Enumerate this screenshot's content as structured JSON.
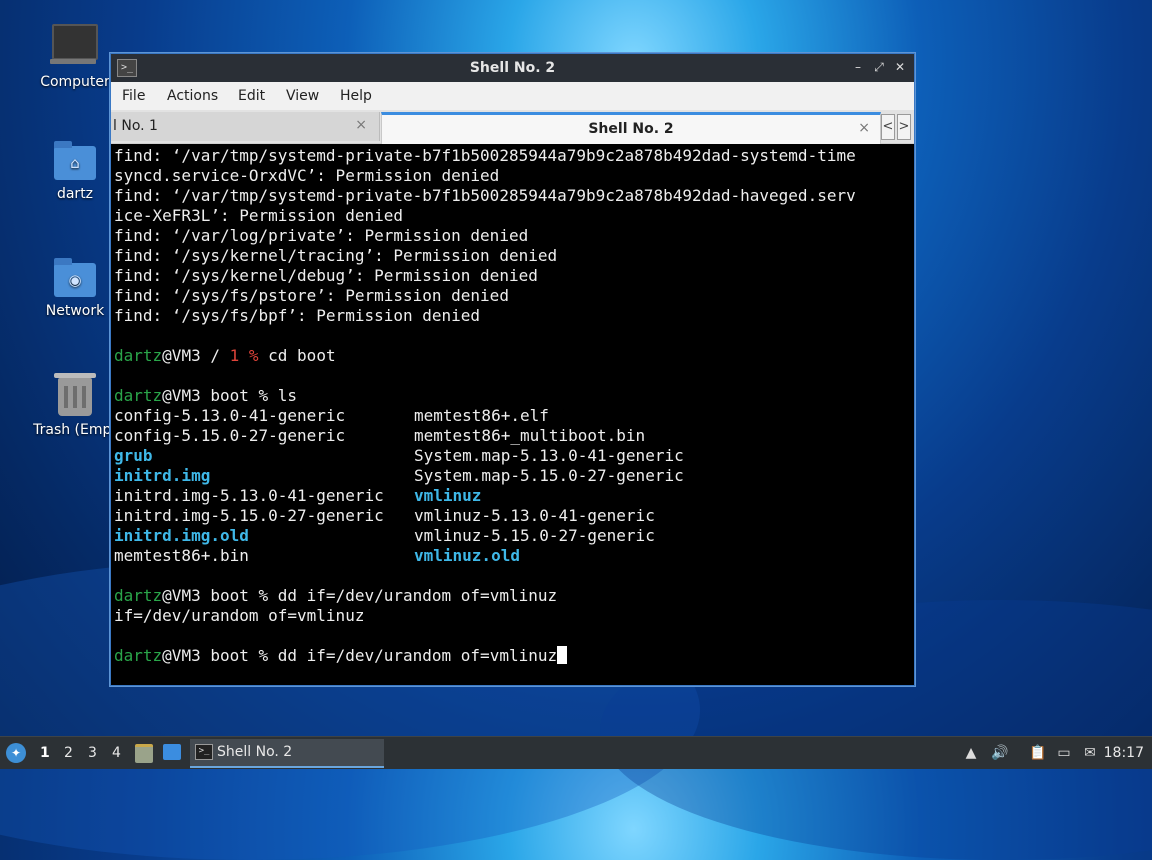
{
  "desktop": {
    "icons": [
      {
        "label": "Computer"
      },
      {
        "label": "dartz"
      },
      {
        "label": "Network"
      },
      {
        "label": "Trash (Empt"
      }
    ]
  },
  "window": {
    "title": "Shell No. 2",
    "menu": [
      "File",
      "Actions",
      "Edit",
      "View",
      "Help"
    ],
    "tabs": [
      {
        "label": "l No. 1",
        "close": "×"
      },
      {
        "label": "Shell No. 2",
        "close": "×"
      }
    ],
    "controls": {
      "minimize": "–",
      "maximize": "⤢",
      "close": "✕"
    },
    "scroll_left": "<",
    "scroll_right": ">"
  },
  "terminal": {
    "lines": [
      "find: ‘/var/tmp/systemd-private-b7f1b500285944a79b9c2a878b492dad-systemd-time",
      "syncd.service-OrxdVC’: Permission denied",
      "find: ‘/var/tmp/systemd-private-b7f1b500285944a79b9c2a878b492dad-haveged.serv",
      "ice-XeFR3L’: Permission denied",
      "find: ‘/var/log/private’: Permission denied",
      "find: ‘/sys/kernel/tracing’: Permission denied",
      "find: ‘/sys/kernel/debug’: Permission denied",
      "find: ‘/sys/fs/pstore’: Permission denied",
      "find: ‘/sys/fs/bpf’: Permission denied"
    ],
    "prompt1": {
      "user": "dartz",
      "host_path": "@VM3 / ",
      "exit": "1 %",
      "cmd": " cd boot"
    },
    "prompt2": {
      "user": "dartz",
      "rest": "@VM3 boot % ls"
    },
    "ls": [
      {
        "left": "config-5.13.0-41-generic",
        "left_dir": false,
        "right": "memtest86+.elf",
        "right_dir": false
      },
      {
        "left": "config-5.15.0-27-generic",
        "left_dir": false,
        "right": "memtest86+_multiboot.bin",
        "right_dir": false
      },
      {
        "left": "grub",
        "left_dir": true,
        "right": "System.map-5.13.0-41-generic",
        "right_dir": false
      },
      {
        "left": "initrd.img",
        "left_dir": true,
        "right": "System.map-5.15.0-27-generic",
        "right_dir": false
      },
      {
        "left": "initrd.img-5.13.0-41-generic",
        "left_dir": false,
        "right": "vmlinuz",
        "right_dir": true
      },
      {
        "left": "initrd.img-5.15.0-27-generic",
        "left_dir": false,
        "right": "vmlinuz-5.13.0-41-generic",
        "right_dir": false
      },
      {
        "left": "initrd.img.old",
        "left_dir": true,
        "right": "vmlinuz-5.15.0-27-generic",
        "right_dir": false
      },
      {
        "left": "memtest86+.bin",
        "left_dir": false,
        "right": "vmlinuz.old",
        "right_dir": true
      }
    ],
    "prompt3": {
      "user": "dartz",
      "rest": "@VM3 boot % dd if=/dev/urandom of=vmlinuz"
    },
    "output3": "if=/dev/urandom of=vmlinuz",
    "prompt4": {
      "user": "dartz",
      "rest": "@VM3 boot % dd if=/dev/urandom of=vmlinuz"
    }
  },
  "taskbar": {
    "start_glyph": "✦",
    "workspaces": [
      "1",
      "2",
      "3",
      "4"
    ],
    "active_workspace": "1",
    "task": "Shell No. 2",
    "task_icon": ">_",
    "tray": {
      "up": "▲",
      "volume": "🔊",
      "clipboard": "📋",
      "network": "▭",
      "notify": "✉"
    },
    "clock": "18:17"
  }
}
